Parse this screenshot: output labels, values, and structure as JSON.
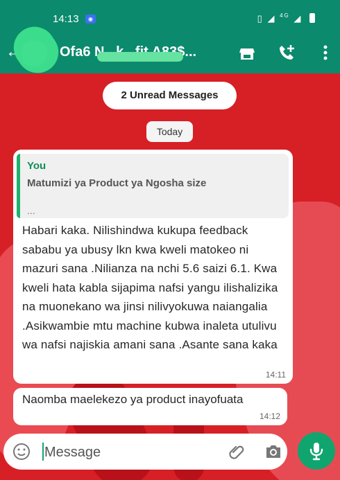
{
  "status_bar": {
    "time": "14:13",
    "network": "4G"
  },
  "header": {
    "contact_name": "Ofa6 N...k...fit A83$..."
  },
  "chat": {
    "unread_banner": "2 Unread Messages",
    "date_chip": "Today",
    "messages": [
      {
        "quote_author": "You",
        "quote_text": "Matumizi ya Product ya Ngosha size",
        "quote_more": "...",
        "text": "Habari kaka. Nilishindwa kukupa feedback sababu ya ubusy lkn kwa kweli matokeo ni mazuri sana .Nilianza na nchi 5.6 saizi 6.1. Kwa kweli hata kabla sijapima nafsi yangu ilishalizika na muonekano wa jinsi nilivyokuwa naiangalia .Asikwambie mtu machine kubwa inaleta utulivu wa nafsi najiskia amani sana .Asante sana kaka",
        "time": "14:11"
      },
      {
        "text": "Naomba maelekezo ya product inayofuata",
        "time": "14:12"
      }
    ]
  },
  "composer": {
    "placeholder": "Message"
  },
  "colors": {
    "brand": "#0b8a6d",
    "accent": "#10a56f",
    "wallpaper": "#d71f26"
  },
  "icons": [
    "back-arrow-icon",
    "store-icon",
    "phone-add-icon",
    "more-vertical-icon",
    "emoji-icon",
    "attachment-icon",
    "camera-icon",
    "mic-icon"
  ]
}
